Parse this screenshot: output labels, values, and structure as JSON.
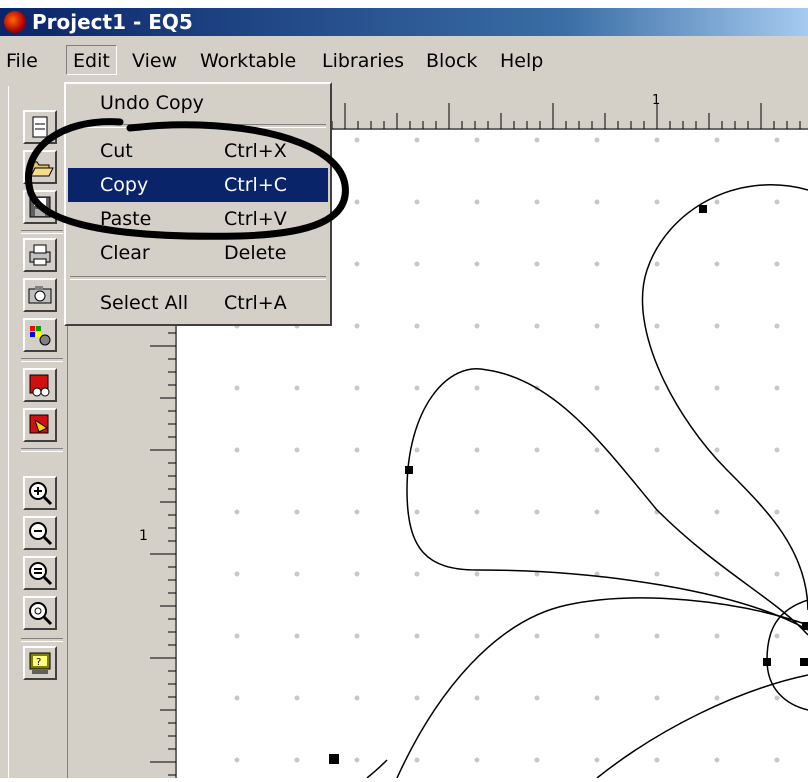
{
  "window": {
    "title": "Project1 - EQ5"
  },
  "menu": {
    "items": [
      "File",
      "Edit",
      "View",
      "Worktable",
      "Libraries",
      "Block",
      "Help"
    ],
    "active": "Edit"
  },
  "edit_menu": {
    "items": [
      {
        "label": "Undo Copy",
        "shortcut": ""
      },
      {
        "label": "Cut",
        "shortcut": "Ctrl+X"
      },
      {
        "label": "Copy",
        "shortcut": "Ctrl+C"
      },
      {
        "label": "Paste",
        "shortcut": "Ctrl+V"
      },
      {
        "label": "Clear",
        "shortcut": "Delete"
      },
      {
        "label": "Select All",
        "shortcut": "Ctrl+A"
      }
    ],
    "highlighted": "Copy"
  },
  "rulers": {
    "top_label": "1",
    "left_label": "1"
  },
  "toolbar": {
    "icons": [
      "new-block-icon",
      "open-icon",
      "save-icon",
      "print-icon",
      "camera-icon",
      "color-palette-icon",
      "block-library-icon",
      "add-to-sketchbook-icon",
      "zoom-in-icon",
      "zoom-out-icon",
      "zoom-fit-icon",
      "zoom-refresh-icon",
      "help-icon"
    ]
  },
  "colors": {
    "titlebar": "#0a246a",
    "menu_highlight": "#0a246a",
    "face": "#d4d0c8",
    "annotation": "#000000"
  }
}
